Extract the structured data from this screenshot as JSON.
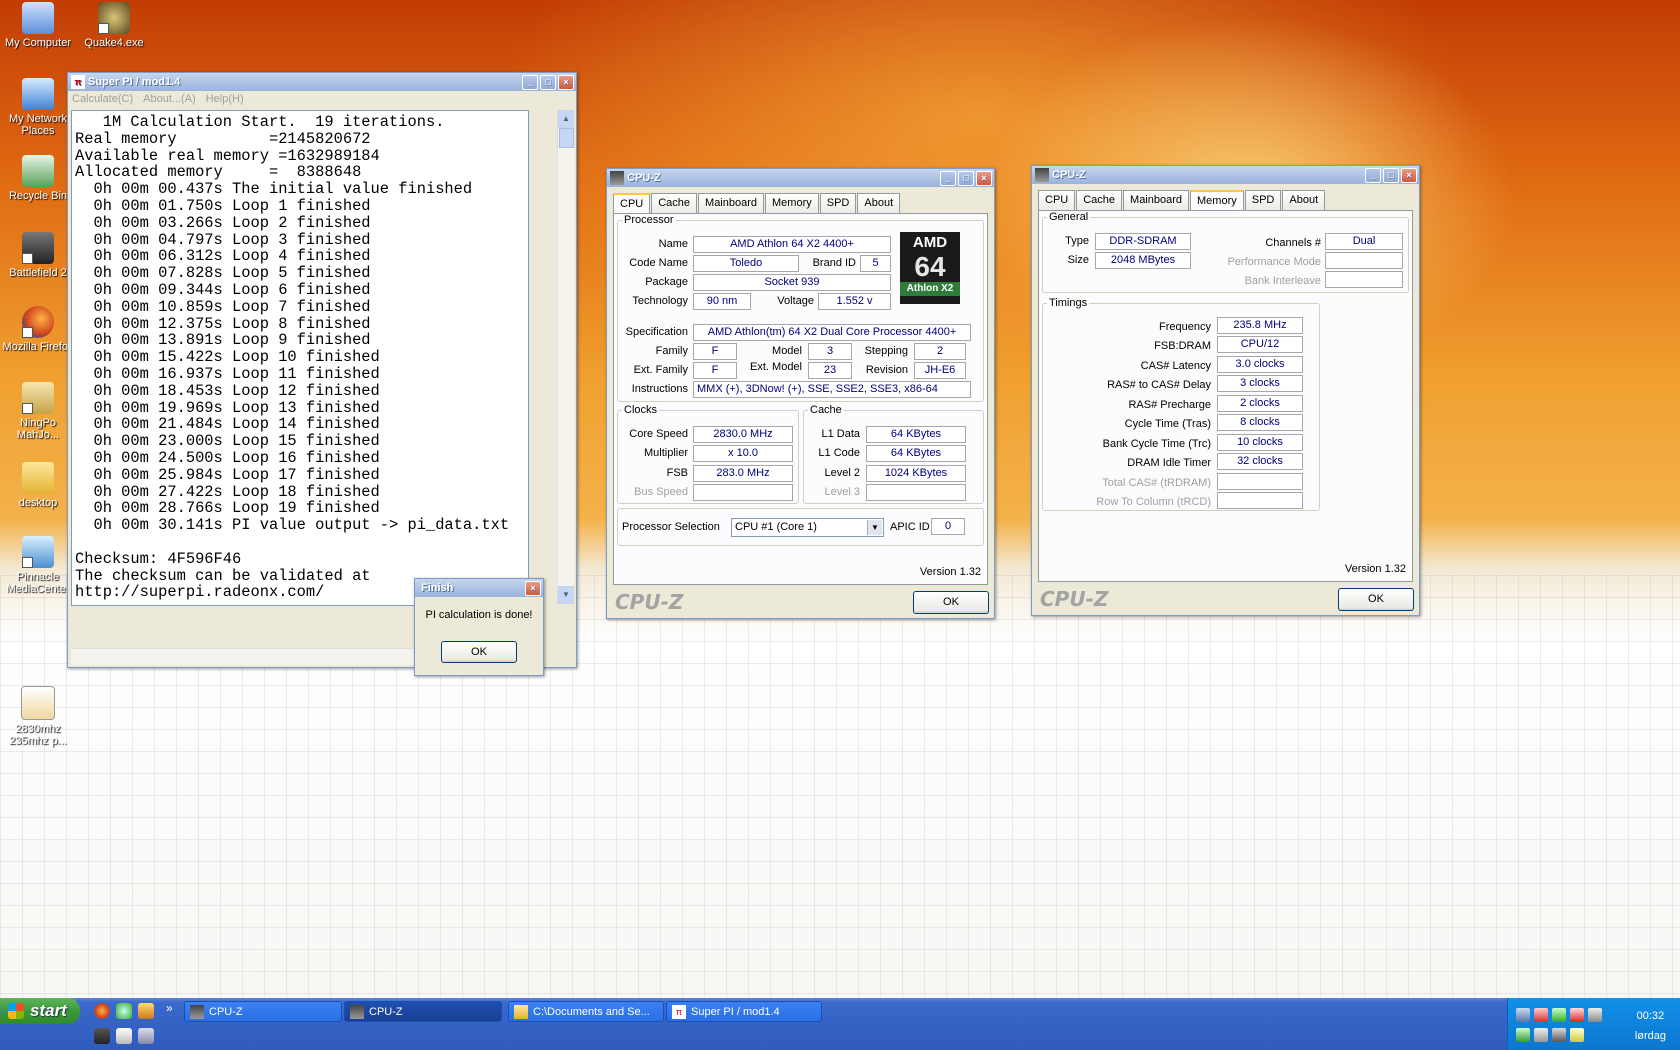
{
  "desktop": {
    "icons": [
      {
        "label": "My Computer"
      },
      {
        "label": "Quake4.exe"
      },
      {
        "label": "My Network Places"
      },
      {
        "label": "Recycle Bin"
      },
      {
        "label": "Battlefield 2"
      },
      {
        "label": "Mozilla Firefox"
      },
      {
        "label": "NingPo MahJo..."
      },
      {
        "label": "desktop"
      },
      {
        "label": "Pinnacle MediaCenter"
      },
      {
        "label": "2830mhz 235mhz p..."
      }
    ]
  },
  "superpi": {
    "title": "Super PI / mod1.4",
    "menu": [
      "Calculate(C)",
      "About...(A)",
      "Help(H)"
    ],
    "output": [
      "   1M Calculation Start.  19 iterations.",
      "Real memory          =2145820672",
      "Available real memory =1632989184",
      "Allocated memory     =  8388648",
      "  0h 00m 00.437s The initial value finished",
      "  0h 00m 01.750s Loop 1 finished",
      "  0h 00m 03.266s Loop 2 finished",
      "  0h 00m 04.797s Loop 3 finished",
      "  0h 00m 06.312s Loop 4 finished",
      "  0h 00m 07.828s Loop 5 finished",
      "  0h 00m 09.344s Loop 6 finished",
      "  0h 00m 10.859s Loop 7 finished",
      "  0h 00m 12.375s Loop 8 finished",
      "  0h 00m 13.891s Loop 9 finished",
      "  0h 00m 15.422s Loop 10 finished",
      "  0h 00m 16.937s Loop 11 finished",
      "  0h 00m 18.453s Loop 12 finished",
      "  0h 00m 19.969s Loop 13 finished",
      "  0h 00m 21.484s Loop 14 finished",
      "  0h 00m 23.000s Loop 15 finished",
      "  0h 00m 24.500s Loop 16 finished",
      "  0h 00m 25.984s Loop 17 finished",
      "  0h 00m 27.422s Loop 18 finished",
      "  0h 00m 28.766s Loop 19 finished",
      "  0h 00m 30.141s PI value output -> pi_data.txt",
      "",
      "Checksum: 4F596F46",
      "The checksum can be validated at",
      "http://superpi.radeonx.com/"
    ]
  },
  "finish": {
    "title": "Finish",
    "message": "PI calculation is done!",
    "ok": "OK"
  },
  "cpuz_cpu": {
    "title": "CPU-Z",
    "tabs": [
      "CPU",
      "Cache",
      "Mainboard",
      "Memory",
      "SPD",
      "About"
    ],
    "processor_legend": "Processor",
    "name_label": "Name",
    "name": "AMD Athlon 64 X2 4400+",
    "codename_label": "Code Name",
    "codename": "Toledo",
    "brandid_label": "Brand ID",
    "brandid": "5",
    "package_label": "Package",
    "package": "Socket 939",
    "technology_label": "Technology",
    "technology": "90 nm",
    "voltage_label": "Voltage",
    "voltage": "1.552 v",
    "logo_top": "AMD",
    "logo_mid": "64",
    "logo_bottom": "Athlon X2",
    "specification_label": "Specification",
    "specification": "AMD Athlon(tm) 64 X2 Dual Core Processor 4400+",
    "family_label": "Family",
    "family": "F",
    "model_label": "Model",
    "model": "3",
    "stepping_label": "Stepping",
    "stepping": "2",
    "extfamily_label": "Ext. Family",
    "extfamily": "F",
    "extmodel_label": "Ext. Model",
    "extmodel": "23",
    "revision_label": "Revision",
    "revision": "JH-E6",
    "instructions_label": "Instructions",
    "instructions": "MMX (+), 3DNow! (+), SSE, SSE2, SSE3, x86-64",
    "clocks_legend": "Clocks",
    "corespeed_label": "Core Speed",
    "corespeed": "2830.0 MHz",
    "multiplier_label": "Multiplier",
    "multiplier": "x 10.0",
    "fsb_label": "FSB",
    "fsb": "283.0 MHz",
    "busspeed_label": "Bus Speed",
    "busspeed": "",
    "cache_legend": "Cache",
    "l1data_label": "L1 Data",
    "l1data": "64 KBytes",
    "l1code_label": "L1 Code",
    "l1code": "64 KBytes",
    "level2_label": "Level 2",
    "level2": "1024 KBytes",
    "level3_label": "Level 3",
    "level3": "",
    "procsel_label": "Processor Selection",
    "procsel": "CPU #1 (Core 1)",
    "apicid_label": "APIC ID",
    "apicid": "0",
    "version": "Version 1.32",
    "brand": "CPU-Z",
    "ok": "OK"
  },
  "cpuz_mem": {
    "title": "CPU-Z",
    "tabs": [
      "CPU",
      "Cache",
      "Mainboard",
      "Memory",
      "SPD",
      "About"
    ],
    "general_legend": "General",
    "type_label": "Type",
    "type": "DDR-SDRAM",
    "size_label": "Size",
    "size": "2048 MBytes",
    "channels_label": "Channels #",
    "channels": "Dual",
    "perfmode_label": "Performance Mode",
    "perfmode": "",
    "bankint_label": "Bank Interleave",
    "bankint": "",
    "timings_legend": "Timings",
    "frequency_label": "Frequency",
    "frequency": "235.8 MHz",
    "fsbdram_label": "FSB:DRAM",
    "fsbdram": "CPU/12",
    "cas_label": "CAS# Latency",
    "cas": "3.0 clocks",
    "rcd_label": "RAS# to CAS# Delay",
    "rcd": "3 clocks",
    "rp_label": "RAS# Precharge",
    "rp": "2 clocks",
    "tras_label": "Cycle Time (Tras)",
    "tras": "8 clocks",
    "trc_label": "Bank Cycle Time (Trc)",
    "trc": "10 clocks",
    "idle_label": "DRAM Idle Timer",
    "idle": "32 clocks",
    "trdram_label": "Total CAS# (tRDRAM)",
    "trdram": "",
    "trcd_label": "Row To Column (tRCD)",
    "trcd": "",
    "version": "Version 1.32",
    "brand": "CPU-Z",
    "ok": "OK"
  },
  "taskbar": {
    "start": "start",
    "tasks": [
      {
        "label": "CPU-Z"
      },
      {
        "label": "CPU-Z"
      },
      {
        "label": "C:\\Documents and Se..."
      },
      {
        "label": "Super PI / mod1.4"
      }
    ],
    "ql_more": "»",
    "clock_time": "00:32",
    "clock_day": "lørdag"
  },
  "colors": {
    "xp_blue": "#3563c5",
    "value_text": "#00007a",
    "start_green": "#3a9a38"
  }
}
